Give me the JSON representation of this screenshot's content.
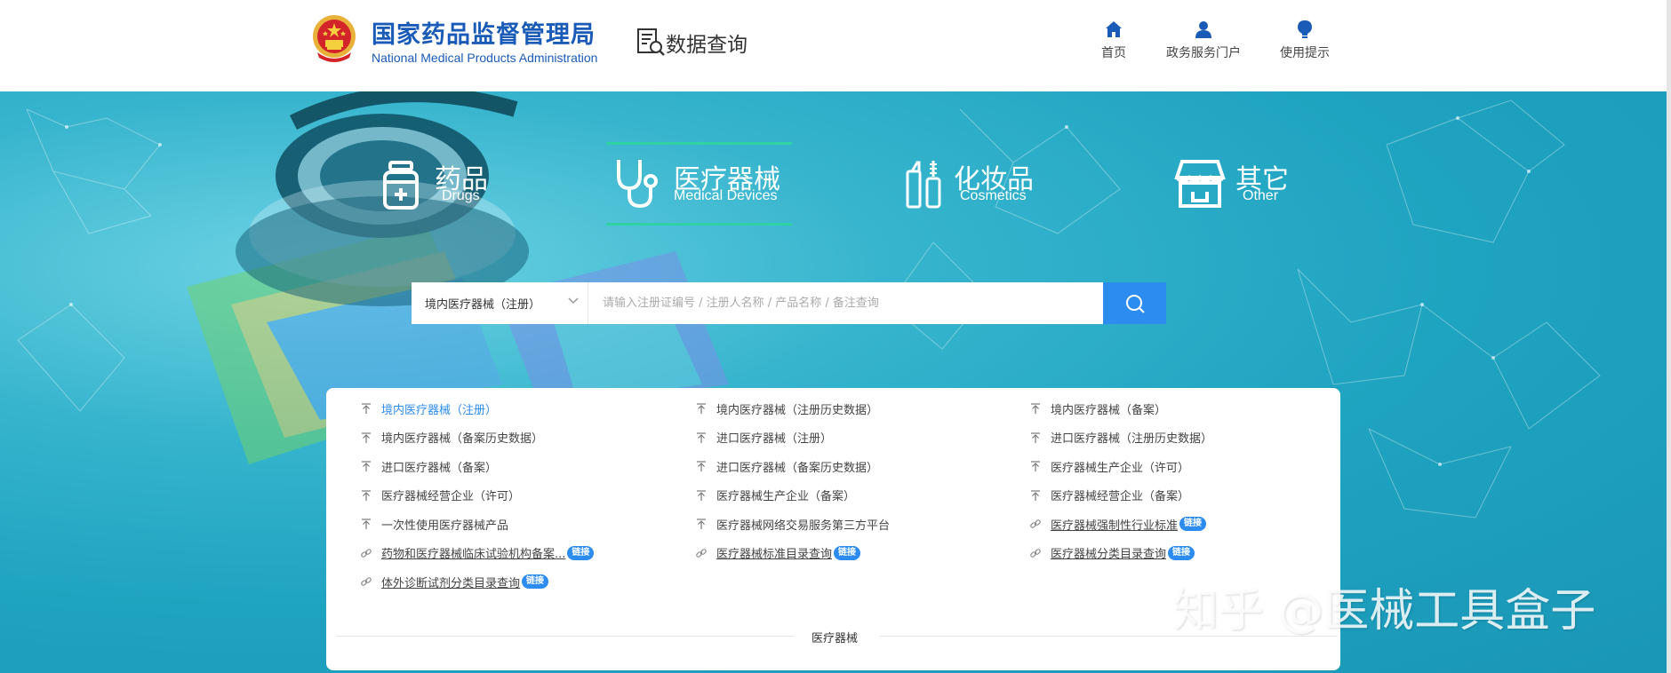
{
  "header": {
    "site_name_cn": "国家药品监督管理局",
    "site_name_en": "National Medical Products Administration",
    "module_title": "数据查询",
    "nav": [
      {
        "label": "首页",
        "icon": "home-icon"
      },
      {
        "label": "政务服务门户",
        "icon": "user-icon"
      },
      {
        "label": "使用提示",
        "icon": "lightbulb-icon"
      }
    ]
  },
  "categories": [
    {
      "cn": "药品",
      "en": "Drugs",
      "icon": "medicine-bottle-icon",
      "active": false
    },
    {
      "cn": "医疗器械",
      "en": "Medical Devices",
      "icon": "stethoscope-icon",
      "active": true
    },
    {
      "cn": "化妆品",
      "en": "Cosmetics",
      "icon": "cosmetics-icon",
      "active": false
    },
    {
      "cn": "其它",
      "en": "Other",
      "icon": "store-icon",
      "active": false
    }
  ],
  "search": {
    "selected_type": "境内医疗器械（注册）",
    "placeholder": "请输入注册证编号 / 注册人名称 / 产品名称 / 备注查询"
  },
  "links": [
    {
      "label": "境内医疗器械（注册）",
      "type": "query",
      "active": true
    },
    {
      "label": "境内医疗器械（注册历史数据）",
      "type": "query"
    },
    {
      "label": "境内医疗器械（备案）",
      "type": "query"
    },
    {
      "label": "境内医疗器械（备案历史数据）",
      "type": "query"
    },
    {
      "label": "进口医疗器械（注册）",
      "type": "query"
    },
    {
      "label": "进口医疗器械（注册历史数据）",
      "type": "query"
    },
    {
      "label": "进口医疗器械（备案）",
      "type": "query"
    },
    {
      "label": "进口医疗器械（备案历史数据）",
      "type": "query"
    },
    {
      "label": "医疗器械生产企业（许可）",
      "type": "query"
    },
    {
      "label": "医疗器械经营企业（许可）",
      "type": "query"
    },
    {
      "label": "医疗器械生产企业（备案）",
      "type": "query"
    },
    {
      "label": "医疗器械经营企业（备案）",
      "type": "query"
    },
    {
      "label": "一次性使用医疗器械产品",
      "type": "query"
    },
    {
      "label": "医疗器械网络交易服务第三方平台",
      "type": "query"
    },
    {
      "label": "医疗器械强制性行业标准",
      "type": "link",
      "tag": "链接"
    },
    {
      "label": "药物和医疗器械临床试验机构备案...",
      "type": "link",
      "tag": "链接"
    },
    {
      "label": "医疗器械标准目录查询",
      "type": "link",
      "tag": "链接"
    },
    {
      "label": "医疗器械分类目录查询",
      "type": "link",
      "tag": "链接"
    },
    {
      "label": "体外诊断试剂分类目录查询",
      "type": "link",
      "tag": "链接"
    }
  ],
  "panel_label": "医疗器械",
  "watermark": "知乎 @医械工具盒子",
  "colors": {
    "brand_blue": "#1a5bb8",
    "accent_blue": "#2d8cf0",
    "active_underline": "#2fd2a3",
    "banner": "#1ea3c0"
  }
}
